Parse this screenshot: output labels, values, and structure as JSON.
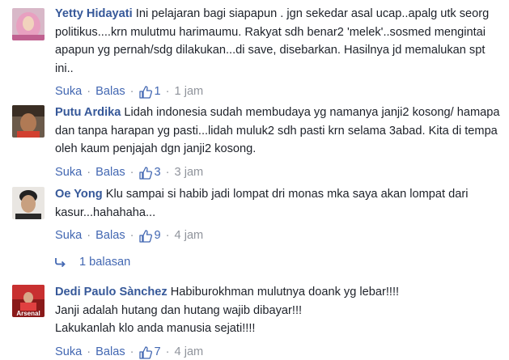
{
  "comments": [
    {
      "author": "Yetty Hidayati",
      "text": "Ini pelajaran bagi siapapun . jgn sekedar asal ucap..apalg utk seorg politikus....krn mulutmu harimaumu. Rakyat sdh benar2 'melek'..sosmed mengintai apapun yg pernah/sdg dilakukan...di save, disebarkan. Hasilnya jd memalukan spt ini..",
      "like_label": "Suka",
      "reply_label": "Balas",
      "likes": "1",
      "time": "1 jam",
      "avatar_icon": "profile-photo-woman-hijab"
    },
    {
      "author": "Putu Ardika",
      "text": "Lidah indonesia sudah membudaya yg namanya janji2 kosong/ hamapa dan tanpa harapan yg pasti...lidah muluk2 sdh pasti krn selama 3abad. Kita di tempa oleh kaum penjajah dgn janji2 kosong.",
      "like_label": "Suka",
      "reply_label": "Balas",
      "likes": "3",
      "time": "3 jam",
      "avatar_icon": "profile-photo-boy"
    },
    {
      "author": "Oe Yong",
      "text": "Klu sampai si habib jadi lompat dri monas mka saya akan lompat dari kasur...hahahaha...",
      "like_label": "Suka",
      "reply_label": "Balas",
      "likes": "9",
      "time": "4 jam",
      "avatar_icon": "profile-photo-man"
    },
    {
      "author": "Dedi Paulo Sànchez",
      "text_lines": [
        "Habiburokhman mulutnya doank yg lebar!!!!",
        "Janji adalah hutang dan hutang wajib dibayar!!!",
        "Lakukanlah klo anda manusia sejati!!!!"
      ],
      "like_label": "Suka",
      "reply_label": "Balas",
      "likes": "7",
      "time": "4 jam",
      "avatar_icon": "profile-photo-arsenal",
      "avatar_text": "Arsenal"
    }
  ],
  "replies_toggle": {
    "label": "1 balasan",
    "icon": "reply-arrow-icon"
  },
  "colors": {
    "link": "#365899",
    "action": "#4267b2",
    "meta": "#90949c",
    "text": "#1d2129"
  }
}
